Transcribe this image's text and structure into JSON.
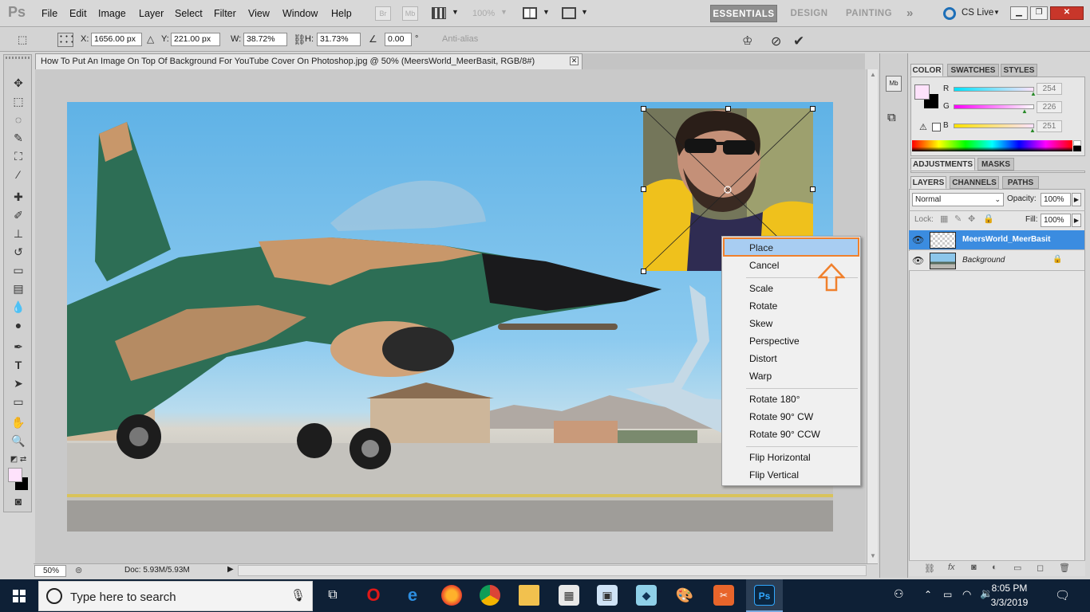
{
  "app": {
    "logo": "Ps",
    "menus": [
      "File",
      "Edit",
      "Image",
      "Layer",
      "Select",
      "Filter",
      "View",
      "Window",
      "Help"
    ],
    "zoom_menu": "100%",
    "workspaces": [
      "ESSENTIALS",
      "DESIGN",
      "PAINTING"
    ],
    "cs_live": "CS Live"
  },
  "options": {
    "x_label": "X:",
    "x_value": "1656.00 px",
    "y_label": "Y:",
    "y_value": "221.00 px",
    "w_label": "W:",
    "w_value": "38.72%",
    "h_label": "H:",
    "h_value": "31.73%",
    "angle_value": "0.00",
    "angle_unit": "°",
    "antialias_label": "Anti-alias"
  },
  "document": {
    "tab_title": "How To Put An Image On Top Of Background For YouTube Cover On Photoshop.jpg @ 50% (MeersWorld_MeerBasit, RGB/8#)",
    "zoom": "50%",
    "doc_size": "Doc: 5.93M/5.93M"
  },
  "context_menu": {
    "items": [
      "Place",
      "Cancel",
      "Scale",
      "Rotate",
      "Skew",
      "Perspective",
      "Distort",
      "Warp",
      "Rotate 180°",
      "Rotate 90° CW",
      "Rotate 90° CCW",
      "Flip Horizontal",
      "Flip Vertical"
    ],
    "highlighted": "Place"
  },
  "color_panel": {
    "tabs": [
      "COLOR",
      "SWATCHES",
      "STYLES"
    ],
    "r_label": "R",
    "r_value": "254",
    "g_label": "G",
    "g_value": "226",
    "b_label": "B",
    "b_value": "251",
    "foreground": "#fee2fb"
  },
  "adjust_panel": {
    "tabs": [
      "ADJUSTMENTS",
      "MASKS"
    ]
  },
  "layers_panel": {
    "tabs": [
      "LAYERS",
      "CHANNELS",
      "PATHS"
    ],
    "blend_mode": "Normal",
    "opacity_label": "Opacity:",
    "opacity_value": "100%",
    "lock_label": "Lock:",
    "fill_label": "Fill:",
    "fill_value": "100%",
    "layers": [
      {
        "name": "MeersWorld_MeerBasit",
        "selected": true
      },
      {
        "name": "Background",
        "selected": false
      }
    ]
  },
  "taskbar": {
    "search_placeholder": "Type here to search",
    "time": "8:05 PM",
    "date": "3/3/2019"
  }
}
